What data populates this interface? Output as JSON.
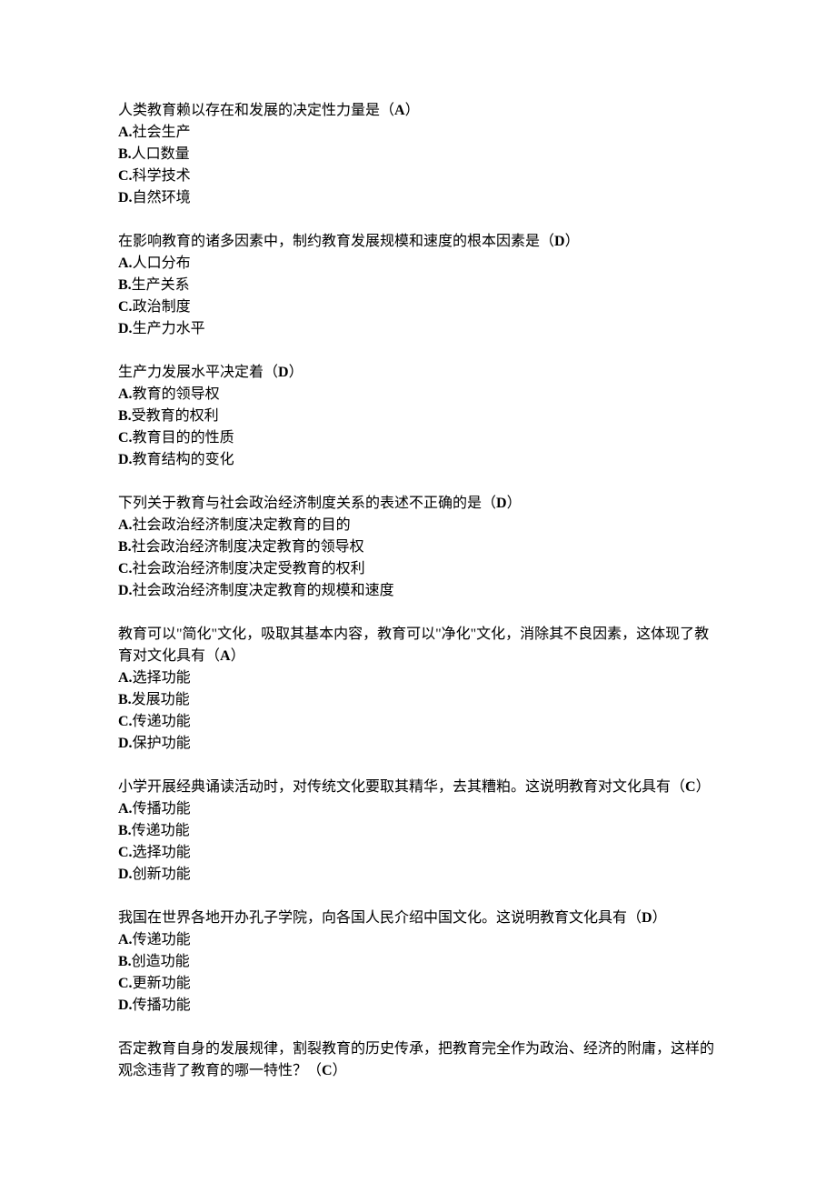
{
  "questions": [
    {
      "stem_pre": "人类教育赖以存在和发展的决定性力量是（",
      "answer": "A",
      "stem_post": "）",
      "options": [
        {
          "letter": "A.",
          "text": "社会生产"
        },
        {
          "letter": "B.",
          "text": "人口数量"
        },
        {
          "letter": "C.",
          "text": "科学技术"
        },
        {
          "letter": "D.",
          "text": "自然环境"
        }
      ]
    },
    {
      "stem_pre": "在影响教育的诸多因素中，制约教育发展规模和速度的根本因素是（",
      "answer": "D",
      "stem_post": "）",
      "options": [
        {
          "letter": "A.",
          "text": "人口分布"
        },
        {
          "letter": "B.",
          "text": "生产关系"
        },
        {
          "letter": "C.",
          "text": "政治制度"
        },
        {
          "letter": "D.",
          "text": "生产力水平"
        }
      ]
    },
    {
      "stem_pre": "生产力发展水平决定着（",
      "answer": "D",
      "stem_post": "）",
      "options": [
        {
          "letter": "A.",
          "text": "教育的领导权"
        },
        {
          "letter": "B.",
          "text": "受教育的权利"
        },
        {
          "letter": "C.",
          "text": "教育目的的性质"
        },
        {
          "letter": "D.",
          "text": "教育结构的变化"
        }
      ]
    },
    {
      "stem_pre": "下列关于教育与社会政治经济制度关系的表述不正确的是（",
      "answer": "D",
      "stem_post": "）",
      "options": [
        {
          "letter": "A.",
          "text": "社会政治经济制度决定教育的目的"
        },
        {
          "letter": "B.",
          "text": "社会政治经济制度决定教育的领导权"
        },
        {
          "letter": "C.",
          "text": "社会政治经济制度决定受教育的权利"
        },
        {
          "letter": "D.",
          "text": "社会政治经济制度决定教育的规模和速度"
        }
      ]
    },
    {
      "stem_pre": "教育可以\"简化\"文化，吸取其基本内容，教育可以\"净化\"文化，消除其不良因素，这体现了教育对文化具有（",
      "answer": "A",
      "stem_post": "）",
      "options": [
        {
          "letter": "A.",
          "text": "选择功能"
        },
        {
          "letter": "B.",
          "text": "发展功能"
        },
        {
          "letter": "C.",
          "text": "传递功能"
        },
        {
          "letter": "D.",
          "text": "保护功能"
        }
      ]
    },
    {
      "stem_pre": "小学开展经典诵读活动时，对传统文化要取其精华，去其糟粕。这说明教育对文化具有（",
      "answer": "C",
      "stem_post": "）",
      "options": [
        {
          "letter": "A.",
          "text": "传播功能"
        },
        {
          "letter": "B.",
          "text": "传递功能"
        },
        {
          "letter": "C.",
          "text": "选择功能"
        },
        {
          "letter": "D.",
          "text": "创新功能"
        }
      ]
    },
    {
      "stem_pre": "我国在世界各地开办孔子学院，向各国人民介绍中国文化。这说明教育文化具有（",
      "answer": "D",
      "stem_post": "）",
      "options": [
        {
          "letter": "A.",
          "text": "传递功能"
        },
        {
          "letter": "B.",
          "text": "创造功能"
        },
        {
          "letter": "C.",
          "text": "更新功能"
        },
        {
          "letter": "D.",
          "text": "传播功能"
        }
      ]
    },
    {
      "stem_pre": "否定教育自身的发展规律，割裂教育的历史传承，把教育完全作为政治、经济的附庸，这样的观念违背了教育的哪一特性？（",
      "answer": "C",
      "stem_post": "）",
      "options": []
    }
  ]
}
